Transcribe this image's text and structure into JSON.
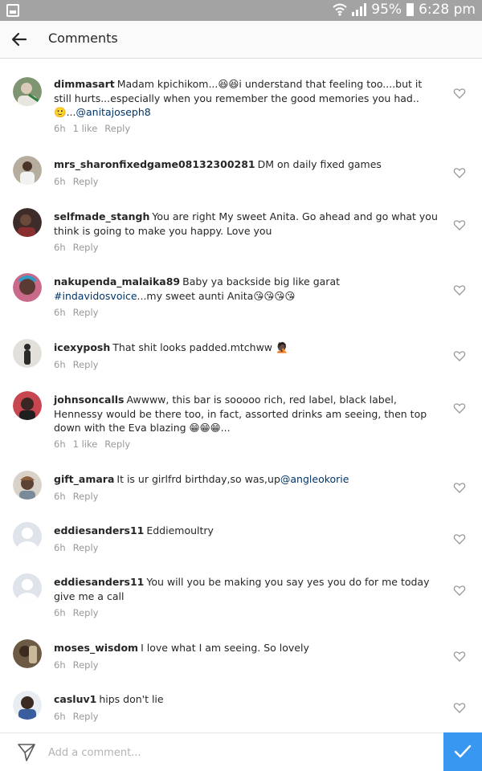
{
  "status_bar": {
    "battery": "95%",
    "time": "6:28 pm"
  },
  "header": {
    "title": "Comments"
  },
  "comments": [
    {
      "username": "dimmasart",
      "text": "Madam kpichikom...😆😆i understand that feeling too....but it still hurts...especially when you remember the good memories you had..",
      "text2": "🙂...",
      "mention": "@anitajoseph8",
      "time": "6h",
      "likes": "1 like",
      "reply": "Reply",
      "avatar_color": "#7f9470"
    },
    {
      "username": "mrs_sharonfixedgame08132300281",
      "text": "DM on daily fixed games",
      "time": "6h",
      "reply": "Reply",
      "avatar_color": "#8b7d6e"
    },
    {
      "username": "selfmade_stangh",
      "text": "You are right My sweet Anita. Go ahead and go what you think is going to make you happy.  Love you",
      "time": "6h",
      "reply": "Reply",
      "avatar_color": "#3d2c2a"
    },
    {
      "username": "nakupenda_malaika89",
      "text": "Baby ya backside big like garat",
      "hashtag": "#indavidosvoice",
      "text_after": "...my sweet aunti Anita😘😘😘😘",
      "time": "6h",
      "reply": "Reply",
      "avatar_color": "#c96a8b"
    },
    {
      "username": "icexyposh",
      "text": "That shit looks padded.mtchww 🤦🏿",
      "time": "6h",
      "reply": "Reply",
      "avatar_color": "#b9b3ad"
    },
    {
      "username": "johnsoncalls",
      "text": "Awwww, this bar is sooooo rich, red label, black label, Hennessy would be there too, in fact, assorted drinks am seeing, then top down with the Eva blazing 😁😁😁...",
      "time": "6h",
      "likes": "1 like",
      "reply": "Reply",
      "avatar_color": "#c8464f"
    },
    {
      "username": "gift_amara",
      "text": "It is ur girlfrd birthday,so was,up",
      "mention": "@angleokorie",
      "time": "6h",
      "reply": "Reply",
      "avatar_color": "#a79b8c"
    },
    {
      "username": "eddiesanders11",
      "text": "Eddiemoultry",
      "time": "6h",
      "reply": "Reply",
      "avatar_color": "#dfe3ea"
    },
    {
      "username": "eddiesanders11",
      "text": "You will you be making you say yes you do for me today give me a call",
      "time": "6h",
      "reply": "Reply",
      "avatar_color": "#dfe3ea"
    },
    {
      "username": "moses_wisdom",
      "text": "I love what I am seeing. So lovely",
      "time": "6h",
      "reply": "Reply",
      "avatar_color": "#6d5a44"
    },
    {
      "username": "casluv1",
      "text": "hips don't lie",
      "time": "6h",
      "reply": "Reply",
      "avatar_color": "#3a5d9e"
    }
  ],
  "composer": {
    "placeholder": "Add a comment..."
  },
  "colors": {
    "accent": "#3897f0",
    "link": "#003569",
    "meta": "#999999"
  }
}
